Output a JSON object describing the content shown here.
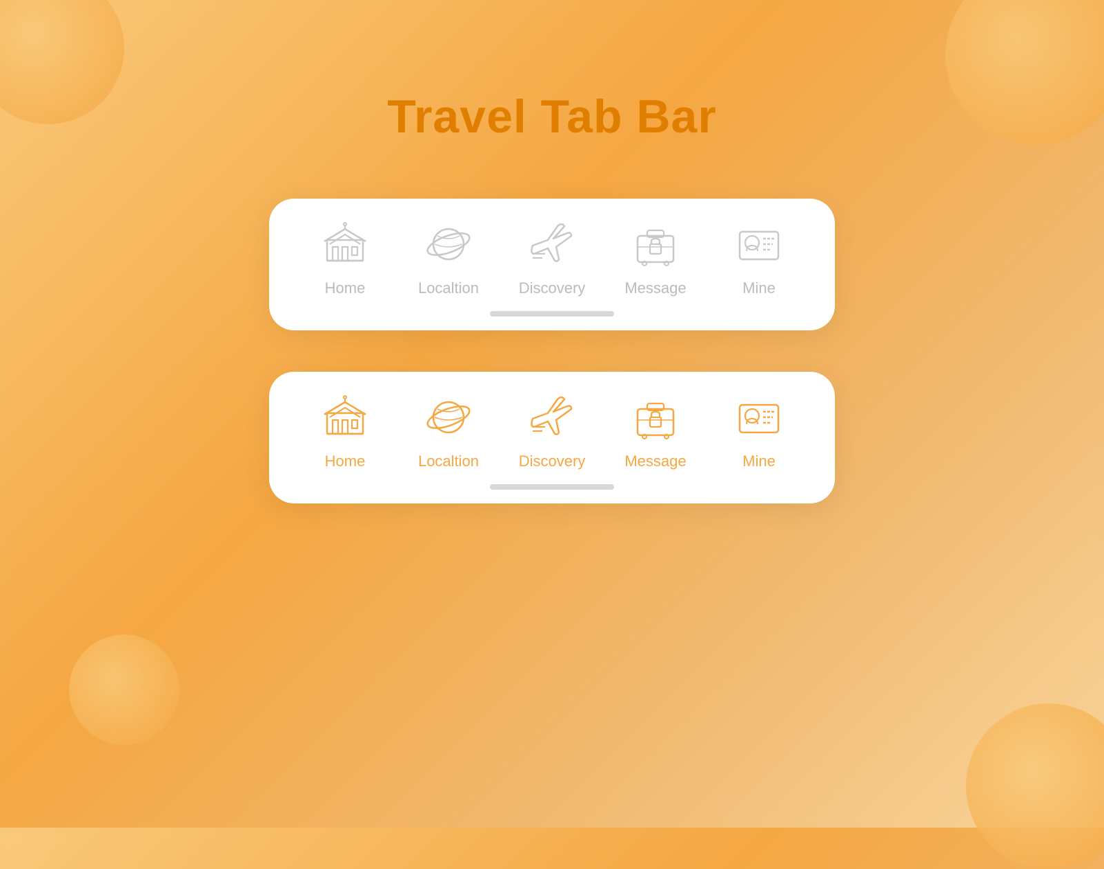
{
  "page": {
    "title": "Travel Tab Bar",
    "title_color": "#e07e00"
  },
  "tab_bars": [
    {
      "id": "inactive-bar",
      "state": "inactive",
      "tabs": [
        {
          "id": "home",
          "label": "Home"
        },
        {
          "id": "location",
          "label": "Localtion"
        },
        {
          "id": "discovery",
          "label": "Discovery"
        },
        {
          "id": "message",
          "label": "Message"
        },
        {
          "id": "mine",
          "label": "Mine"
        }
      ]
    },
    {
      "id": "active-bar",
      "state": "active",
      "tabs": [
        {
          "id": "home",
          "label": "Home"
        },
        {
          "id": "location",
          "label": "Localtion"
        },
        {
          "id": "discovery",
          "label": "Discovery"
        },
        {
          "id": "message",
          "label": "Message"
        },
        {
          "id": "mine",
          "label": "Mine"
        }
      ]
    }
  ]
}
